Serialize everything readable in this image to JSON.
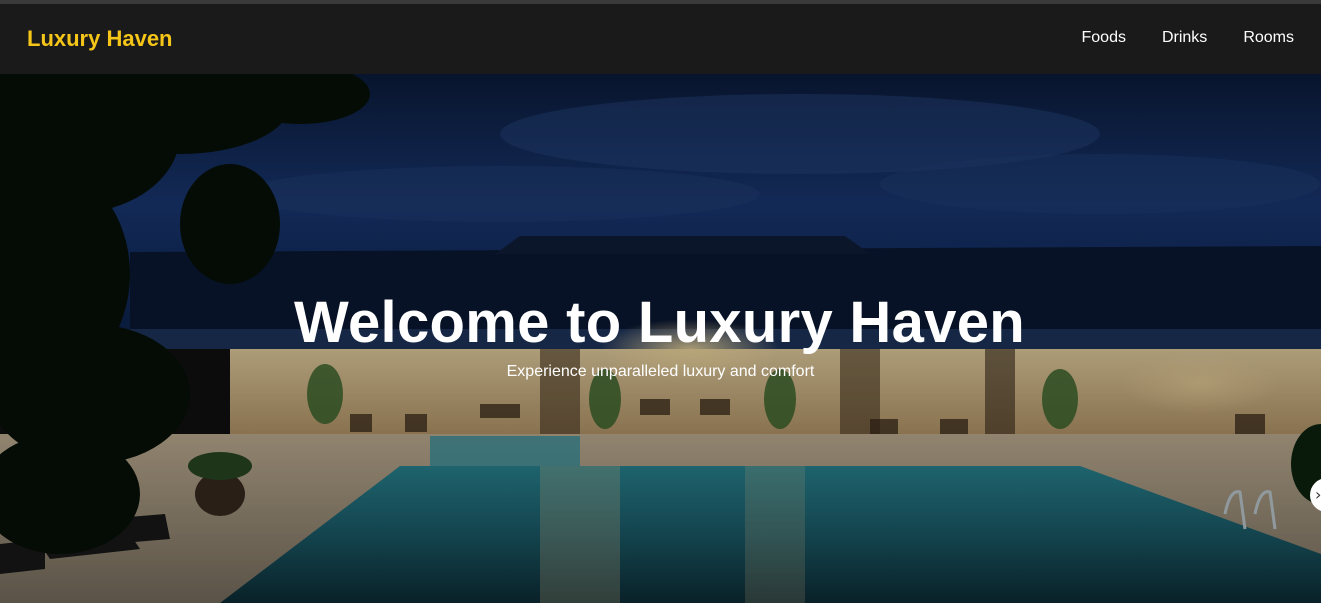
{
  "navbar": {
    "brand": "Luxury Haven",
    "links": [
      "Foods",
      "Drinks",
      "Rooms"
    ]
  },
  "hero": {
    "title": "Welcome to Luxury Haven",
    "subtitle": "Experience unparalleled luxury and comfort",
    "next_icon": "chevron-right-icon"
  },
  "colors": {
    "brand": "#f5c518",
    "navbar_bg": "#1a1a1a",
    "text": "#ffffff"
  }
}
